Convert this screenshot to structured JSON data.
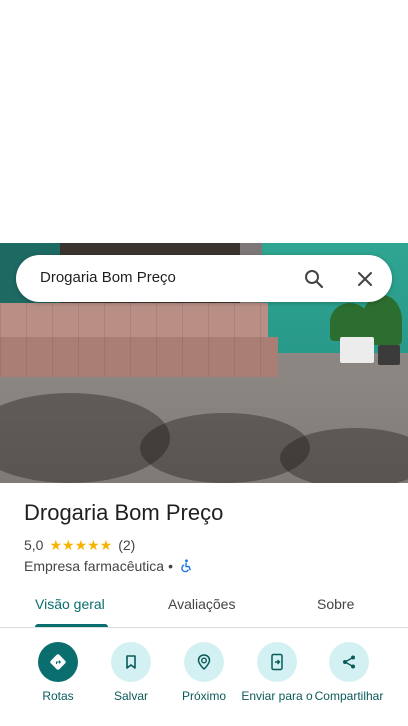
{
  "search": {
    "query": "Drogaria Bom Preço"
  },
  "place": {
    "name": "Drogaria Bom Preço",
    "rating": "5,0",
    "stars": "★★★★★",
    "review_count": "(2)",
    "category": "Empresa farmacêutica",
    "separator": "•"
  },
  "tabs": [
    {
      "label": "Visão geral",
      "active": true
    },
    {
      "label": "Avaliações",
      "active": false
    },
    {
      "label": "Sobre",
      "active": false
    }
  ],
  "actions": [
    {
      "label": "Rotas",
      "icon": "directions-icon"
    },
    {
      "label": "Salvar",
      "icon": "bookmark-icon"
    },
    {
      "label": "Próximo",
      "icon": "nearby-icon"
    },
    {
      "label": "Enviar para o",
      "icon": "send-to-phone-icon"
    },
    {
      "label": "Compartilhar",
      "icon": "share-icon"
    }
  ],
  "colors": {
    "accent": "#0b6e6e",
    "accent_light": "#d3f1f2",
    "star": "#f6b400"
  }
}
